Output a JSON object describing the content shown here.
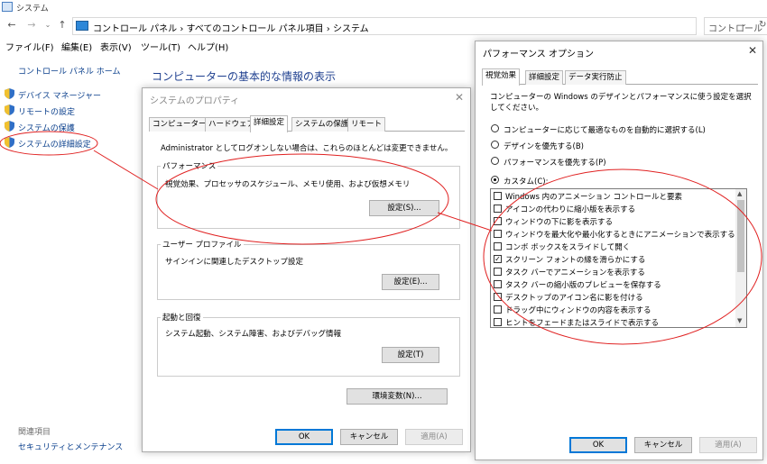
{
  "window": {
    "title": "システム"
  },
  "addressbar": {
    "crumbs": "コントロール パネル  ›  すべてのコントロール パネル項目  ›  システム",
    "search_placeholder": "コントロール"
  },
  "menu": [
    "ファイル(F)",
    "編集(E)",
    "表示(V)",
    "ツール(T)",
    "ヘルプ(H)"
  ],
  "left_pane": {
    "home": "コントロール パネル ホーム",
    "links": [
      "デバイス マネージャー",
      "リモートの設定",
      "システムの保護",
      "システムの詳細設定"
    ],
    "related_title": "関連項目",
    "related_link": "セキュリティとメンテナンス"
  },
  "main": {
    "heading": "コンピューターの基本的な情報の表示"
  },
  "sysprops": {
    "title": "システムのプロパティ",
    "tabs": [
      "コンピューター名",
      "ハードウェア",
      "詳細設定",
      "システムの保護",
      "リモート"
    ],
    "admin_note": "Administrator としてログオンしない場合は、これらのほとんどは変更できません。",
    "perf_label": "パフォーマンス",
    "perf_desc": "視覚効果、プロセッサのスケジュール、メモリ使用、および仮想メモリ",
    "perf_button": "設定(S)...",
    "profile_label": "ユーザー プロファイル",
    "profile_desc": "サインインに関連したデスクトップ設定",
    "profile_button": "設定(E)...",
    "startup_label": "起動と回復",
    "startup_desc": "システム起動、システム障害、およびデバッグ情報",
    "startup_button": "設定(T)",
    "env_button": "環境変数(N)...",
    "ok": "OK",
    "cancel": "キャンセル",
    "apply": "適用(A)"
  },
  "perfopts": {
    "title": "パフォーマンス オプション",
    "tabs": [
      "視覚効果",
      "詳細設定",
      "データ実行防止"
    ],
    "description": "コンピューターの Windows のデザインとパフォーマンスに使う設定を選択してください。",
    "radios": [
      {
        "label": "コンピューターに応じて最適なものを自動的に選択する(L)",
        "selected": false
      },
      {
        "label": "デザインを優先する(B)",
        "selected": false
      },
      {
        "label": "パフォーマンスを優先する(P)",
        "selected": false
      },
      {
        "label": "カスタム(C):",
        "selected": true
      }
    ],
    "options": [
      {
        "label": "Windows 内のアニメーション コントロールと要素",
        "checked": false
      },
      {
        "label": "アイコンの代わりに縮小版を表示する",
        "checked": false
      },
      {
        "label": "ウィンドウの下に影を表示する",
        "checked": false
      },
      {
        "label": "ウィンドウを最大化や最小化するときにアニメーションで表示する",
        "checked": false
      },
      {
        "label": "コンボ ボックスをスライドして開く",
        "checked": false
      },
      {
        "label": "スクリーン フォントの縁を滑らかにする",
        "checked": true
      },
      {
        "label": "タスク バーでアニメーションを表示する",
        "checked": false
      },
      {
        "label": "タスク バーの縮小版のプレビューを保存する",
        "checked": false
      },
      {
        "label": "デスクトップのアイコン名に影を付ける",
        "checked": false
      },
      {
        "label": "ドラッグ中にウィンドウの内容を表示する",
        "checked": false
      },
      {
        "label": "ヒントをフェードまたはスライドで表示する",
        "checked": false
      }
    ],
    "ok": "OK",
    "cancel": "キャンセル",
    "apply": "適用(A)"
  },
  "colors": {
    "link": "#0a3f8c",
    "heading": "#1e3f8f",
    "annotation": "#e02020",
    "accent": "#0078d7"
  }
}
